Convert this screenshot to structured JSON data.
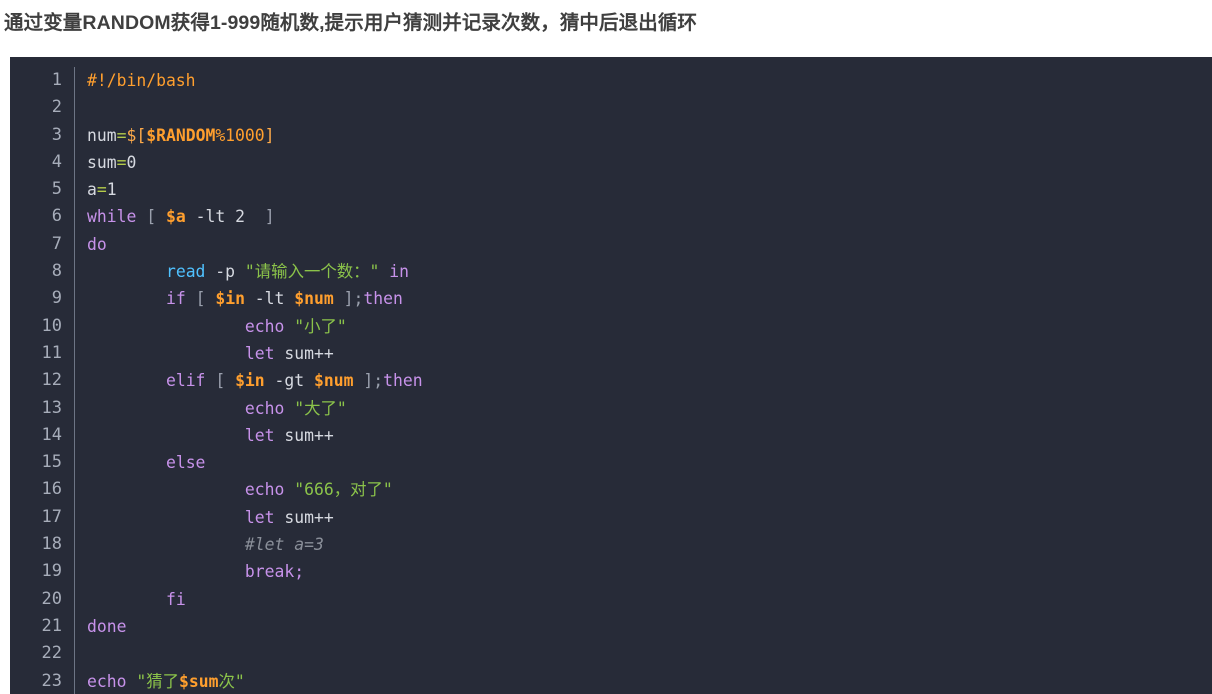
{
  "page": {
    "title": "通过变量RANDOM获得1-999随机数,提示用户猜测并记录次数，猜中后退出循环",
    "background": "#ffffff",
    "title_color": "#3f3f3f"
  },
  "code_block": {
    "language": "bash",
    "background": "#272b38",
    "gutter_color": "#a7adba",
    "default_text_color": "#d5d8de",
    "colors": {
      "comment": "#ff9f2e",
      "comment_grey": "#8a8f99",
      "keyword": "#c792ea",
      "function": "#4fc1ff",
      "variable": "#ff9f2e",
      "number": "#ff9f2e",
      "string": "#8bc34a",
      "operator": "#b5cc4a",
      "punctuation": "#9aa0ad",
      "bracket": "#ffab4a"
    },
    "line_numbers": [
      1,
      2,
      3,
      4,
      5,
      6,
      7,
      8,
      9,
      10,
      11,
      12,
      13,
      14,
      15,
      16,
      17,
      18,
      19,
      20,
      21,
      22,
      23
    ],
    "lines": [
      {
        "n": 1,
        "text": "#!/bin/bash"
      },
      {
        "n": 2,
        "text": ""
      },
      {
        "n": 3,
        "text": "num=$[$RANDOM%1000]"
      },
      {
        "n": 4,
        "text": "sum=0"
      },
      {
        "n": 5,
        "text": "a=1"
      },
      {
        "n": 6,
        "text": "while [ $a -lt 2  ]"
      },
      {
        "n": 7,
        "text": "do"
      },
      {
        "n": 8,
        "text": "        read -p \"请输入一个数：\" in"
      },
      {
        "n": 9,
        "text": "        if [ $in -lt $num ];then"
      },
      {
        "n": 10,
        "text": "                echo \"小了\""
      },
      {
        "n": 11,
        "text": "                let sum++"
      },
      {
        "n": 12,
        "text": "        elif [ $in -gt $num ];then"
      },
      {
        "n": 13,
        "text": "                echo \"大了\""
      },
      {
        "n": 14,
        "text": "                let sum++"
      },
      {
        "n": 15,
        "text": "        else"
      },
      {
        "n": 16,
        "text": "                echo \"666，对了\""
      },
      {
        "n": 17,
        "text": "                let sum++"
      },
      {
        "n": 18,
        "text": "                #let a=3"
      },
      {
        "n": 19,
        "text": "                break;"
      },
      {
        "n": 20,
        "text": "        fi"
      },
      {
        "n": 21,
        "text": "done"
      },
      {
        "n": 22,
        "text": ""
      },
      {
        "n": 23,
        "text": "echo \"猜了$sum次\""
      }
    ],
    "tokens": [
      [
        {
          "t": "#!/bin/bash",
          "c": "t-comment"
        }
      ],
      [],
      [
        {
          "t": "num",
          "c": "t-plain"
        },
        {
          "t": "=",
          "c": "t-op"
        },
        {
          "t": "$[",
          "c": "t-brk"
        },
        {
          "t": "$RANDOM",
          "c": "t-var"
        },
        {
          "t": "%1000",
          "c": "t-num"
        },
        {
          "t": "]",
          "c": "t-brk"
        }
      ],
      [
        {
          "t": "sum",
          "c": "t-plain"
        },
        {
          "t": "=",
          "c": "t-op"
        },
        {
          "t": "0",
          "c": "t-plain"
        }
      ],
      [
        {
          "t": "a",
          "c": "t-plain"
        },
        {
          "t": "=",
          "c": "t-op"
        },
        {
          "t": "1",
          "c": "t-plain"
        }
      ],
      [
        {
          "t": "while",
          "c": "t-kw"
        },
        {
          "t": " ",
          "c": "t-plain"
        },
        {
          "t": "[",
          "c": "t-punc"
        },
        {
          "t": " ",
          "c": "t-plain"
        },
        {
          "t": "$a",
          "c": "t-var"
        },
        {
          "t": " -lt ",
          "c": "t-plain"
        },
        {
          "t": "2",
          "c": "t-plain"
        },
        {
          "t": "  ",
          "c": "t-plain"
        },
        {
          "t": "]",
          "c": "t-punc"
        }
      ],
      [
        {
          "t": "do",
          "c": "t-kw"
        }
      ],
      [
        {
          "t": "        ",
          "c": "t-plain"
        },
        {
          "t": "read",
          "c": "t-fn"
        },
        {
          "t": " -p ",
          "c": "t-plain"
        },
        {
          "t": "\"请输入一个数：\"",
          "c": "t-str"
        },
        {
          "t": " ",
          "c": "t-plain"
        },
        {
          "t": "in",
          "c": "t-kw"
        }
      ],
      [
        {
          "t": "        ",
          "c": "t-plain"
        },
        {
          "t": "if",
          "c": "t-kw"
        },
        {
          "t": " ",
          "c": "t-plain"
        },
        {
          "t": "[",
          "c": "t-punc"
        },
        {
          "t": " ",
          "c": "t-plain"
        },
        {
          "t": "$in",
          "c": "t-var"
        },
        {
          "t": " -lt ",
          "c": "t-plain"
        },
        {
          "t": "$num",
          "c": "t-var"
        },
        {
          "t": " ",
          "c": "t-plain"
        },
        {
          "t": "]",
          "c": "t-punc"
        },
        {
          "t": ";",
          "c": "t-punc"
        },
        {
          "t": "then",
          "c": "t-kw"
        }
      ],
      [
        {
          "t": "                ",
          "c": "t-plain"
        },
        {
          "t": "echo",
          "c": "t-kw"
        },
        {
          "t": " ",
          "c": "t-plain"
        },
        {
          "t": "\"小了\"",
          "c": "t-str"
        }
      ],
      [
        {
          "t": "                ",
          "c": "t-plain"
        },
        {
          "t": "let",
          "c": "t-kw"
        },
        {
          "t": " ",
          "c": "t-plain"
        },
        {
          "t": "sum++",
          "c": "t-plain"
        }
      ],
      [
        {
          "t": "        ",
          "c": "t-plain"
        },
        {
          "t": "elif",
          "c": "t-kw"
        },
        {
          "t": " ",
          "c": "t-plain"
        },
        {
          "t": "[",
          "c": "t-punc"
        },
        {
          "t": " ",
          "c": "t-plain"
        },
        {
          "t": "$in",
          "c": "t-var"
        },
        {
          "t": " -gt ",
          "c": "t-plain"
        },
        {
          "t": "$num",
          "c": "t-var"
        },
        {
          "t": " ",
          "c": "t-plain"
        },
        {
          "t": "]",
          "c": "t-punc"
        },
        {
          "t": ";",
          "c": "t-punc"
        },
        {
          "t": "then",
          "c": "t-kw"
        }
      ],
      [
        {
          "t": "                ",
          "c": "t-plain"
        },
        {
          "t": "echo",
          "c": "t-kw"
        },
        {
          "t": " ",
          "c": "t-plain"
        },
        {
          "t": "\"大了\"",
          "c": "t-str"
        }
      ],
      [
        {
          "t": "                ",
          "c": "t-plain"
        },
        {
          "t": "let",
          "c": "t-kw"
        },
        {
          "t": " ",
          "c": "t-plain"
        },
        {
          "t": "sum++",
          "c": "t-plain"
        }
      ],
      [
        {
          "t": "        ",
          "c": "t-plain"
        },
        {
          "t": "else",
          "c": "t-kw"
        }
      ],
      [
        {
          "t": "                ",
          "c": "t-plain"
        },
        {
          "t": "echo",
          "c": "t-kw"
        },
        {
          "t": " ",
          "c": "t-plain"
        },
        {
          "t": "\"666，对了\"",
          "c": "t-str"
        }
      ],
      [
        {
          "t": "                ",
          "c": "t-plain"
        },
        {
          "t": "let",
          "c": "t-kw"
        },
        {
          "t": " ",
          "c": "t-plain"
        },
        {
          "t": "sum++",
          "c": "t-plain"
        }
      ],
      [
        {
          "t": "                ",
          "c": "t-plain"
        },
        {
          "t": "#let a=3",
          "c": "t-greycom"
        }
      ],
      [
        {
          "t": "                ",
          "c": "t-plain"
        },
        {
          "t": "break;",
          "c": "t-kw"
        }
      ],
      [
        {
          "t": "        ",
          "c": "t-plain"
        },
        {
          "t": "fi",
          "c": "t-kw"
        }
      ],
      [
        {
          "t": "done",
          "c": "t-kw"
        }
      ],
      [],
      [
        {
          "t": "echo",
          "c": "t-kw"
        },
        {
          "t": " ",
          "c": "t-plain"
        },
        {
          "t": "\"猜了",
          "c": "t-str"
        },
        {
          "t": "$sum",
          "c": "t-var"
        },
        {
          "t": "次\"",
          "c": "t-str"
        }
      ]
    ]
  }
}
